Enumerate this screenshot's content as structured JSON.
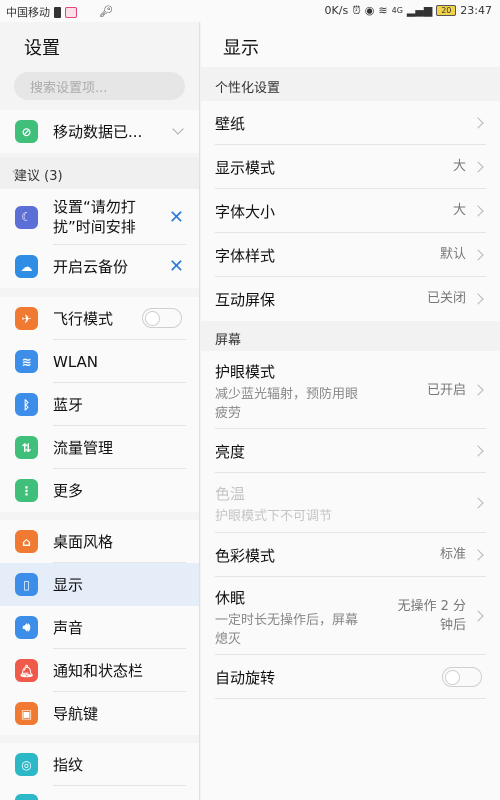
{
  "status_bar": {
    "carrier": "中国移动",
    "speed": "0K/s",
    "network": "4G",
    "battery": "20",
    "time": "23:47"
  },
  "left_pane": {
    "title": "设置",
    "search_placeholder": "搜索设置项...",
    "mobile_data": {
      "label": "移动数据已...",
      "icon": "mobile-data-off-icon",
      "color": "#3fbf7a"
    },
    "suggestions_header": "建议 (3)",
    "suggestions": [
      {
        "label_line1": "设置“请勿打",
        "label_line2": "扰”时间安排",
        "icon": "moon-icon",
        "color": "#5b6fd6"
      },
      {
        "label": "开启云备份",
        "icon": "cloud-backup-icon",
        "color": "#2f8de4"
      }
    ],
    "network_items": [
      {
        "label": "飞行模式",
        "icon": "airplane-icon",
        "color": "#f07a32"
      },
      {
        "label": "WLAN",
        "icon": "wifi-icon",
        "color": "#3d8ee8"
      },
      {
        "label": "蓝牙",
        "icon": "bluetooth-icon",
        "color": "#3d8ee8"
      },
      {
        "label": "流量管理",
        "icon": "traffic-icon",
        "color": "#3fbf7a"
      },
      {
        "label": "更多",
        "icon": "more-icon",
        "color": "#3fbf7a"
      }
    ],
    "device_items": [
      {
        "label": "桌面风格",
        "icon": "home-icon",
        "color": "#f07a32"
      },
      {
        "label": "显示",
        "icon": "display-icon",
        "color": "#3d8ee8"
      },
      {
        "label": "声音",
        "icon": "sound-icon",
        "color": "#3d8ee8"
      },
      {
        "label": "通知和状态栏",
        "icon": "bell-icon",
        "color": "#f05a4a"
      },
      {
        "label": "导航键",
        "icon": "navigation-key-icon",
        "color": "#f07a32"
      }
    ],
    "security_items": [
      {
        "label": "指纹",
        "icon": "fingerprint-icon",
        "color": "#2db8c8"
      }
    ]
  },
  "right_pane": {
    "title": "显示",
    "section_personalize": "个性化设置",
    "wallpaper": {
      "title": "壁纸"
    },
    "display_mode": {
      "title": "显示模式",
      "value": "大"
    },
    "font_size": {
      "title": "字体大小",
      "value": "大"
    },
    "font_style": {
      "title": "字体样式",
      "value": "默认"
    },
    "screensaver": {
      "title": "互动屏保",
      "value": "已关闭"
    },
    "section_screen": "屏幕",
    "eye_comfort": {
      "title": "护眼模式",
      "sub_line1": "减少蓝光辐射，预防用眼",
      "sub_line2": "疲劳",
      "value": "已开启"
    },
    "brightness": {
      "title": "亮度"
    },
    "color_temp": {
      "title": "色温",
      "sub": "护眼模式下不可调节"
    },
    "color_mode": {
      "title": "色彩模式",
      "value": "标准"
    },
    "sleep": {
      "title": "休眠",
      "sub_line1": "一定时长无操作后，屏幕",
      "sub_line2": "熄灭",
      "value_line1": "无操作 2 分",
      "value_line2": "钟后"
    },
    "auto_rotate": {
      "title": "自动旋转"
    }
  }
}
